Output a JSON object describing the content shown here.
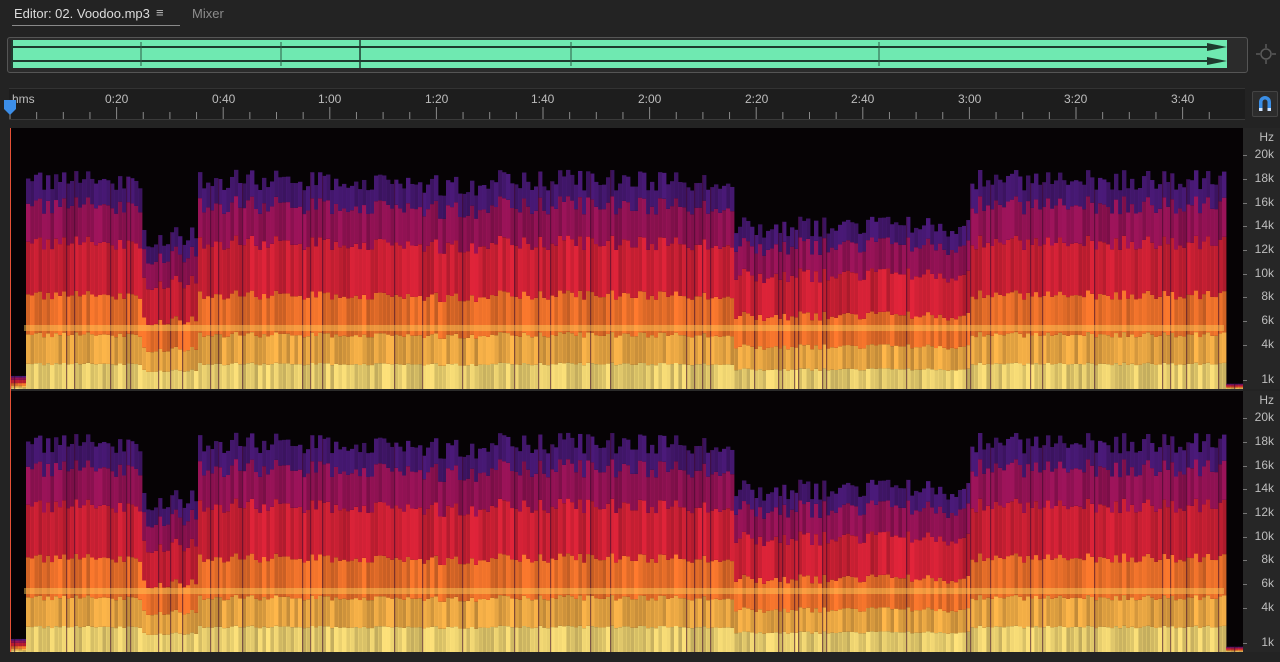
{
  "tabs": {
    "editor_label": "Editor: 02. Voodoo.mp3",
    "menu_glyph": "≡",
    "mixer_label": "Mixer"
  },
  "overview": {
    "color": "#6fe9b1",
    "zoom_icon": "zoom-navigator-icon"
  },
  "ruler": {
    "unit": "hms",
    "ticks": [
      "0:20",
      "0:40",
      "1:00",
      "1:20",
      "1:40",
      "2:00",
      "2:20",
      "2:40",
      "3:00",
      "3:20",
      "3:40"
    ],
    "snap_icon": "magnet-icon",
    "playhead_icon": "playhead-marker-icon"
  },
  "spectral": {
    "unit": "Hz",
    "labels": [
      "20k",
      "18k",
      "16k",
      "14k",
      "12k",
      "10k",
      "8k",
      "6k",
      "4k",
      "1k"
    ],
    "channels": [
      "left-channel",
      "right-channel"
    ]
  }
}
